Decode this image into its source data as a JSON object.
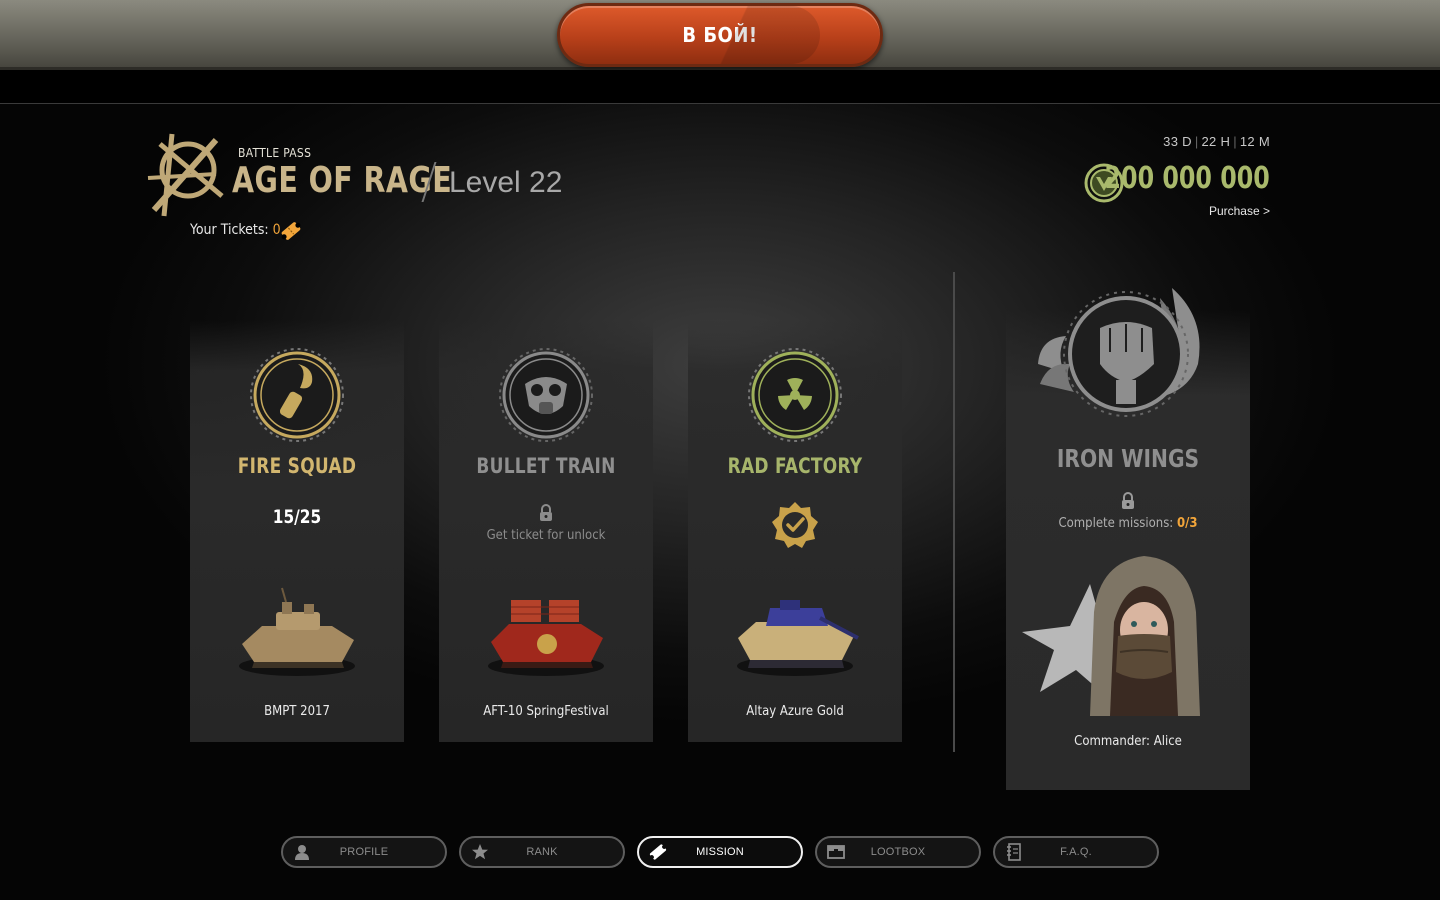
{
  "top_bar": {
    "battle_button_label": "В БОЙ!"
  },
  "header": {
    "subtitle": "BATTLE PASS",
    "title": "AGE OF RAGE",
    "level": "Level 22",
    "tickets_label": "Your Tickets: ",
    "tickets_value": "0",
    "timer": {
      "days": "33 D",
      "hours": "22 H",
      "minutes": "12 M"
    },
    "currency_amount": "200 000 000",
    "purchase_label": "Purchase >"
  },
  "cards": [
    {
      "title": "FIRE SQUAD",
      "title_color": "#d2b66f",
      "progress": "15/25",
      "vehicle": "BMPT 2017",
      "state": "in-progress"
    },
    {
      "title": "BULLET TRAIN",
      "title_color": "#8f8f8f",
      "lock_text": "Get ticket for unlock",
      "vehicle": "AFT-10 SpringFestival",
      "state": "locked"
    },
    {
      "title": "RAD FACTORY",
      "title_color": "#a7b56b",
      "vehicle": "Altay Azure Gold",
      "state": "completed"
    }
  ],
  "special_card": {
    "title": "IRON WINGS",
    "missions_label": "Complete missions: ",
    "missions_value": "0/3",
    "reward": "Commander: Alice"
  },
  "nav": [
    {
      "label": "PROFILE",
      "icon": "user-icon",
      "active": false
    },
    {
      "label": "RANK",
      "icon": "star-icon",
      "active": false
    },
    {
      "label": "MISSION",
      "icon": "ticket-icon",
      "active": true
    },
    {
      "label": "LOOTBOX",
      "icon": "box-icon",
      "active": false
    },
    {
      "label": "F.A.Q.",
      "icon": "notebook-icon",
      "active": false
    }
  ],
  "colors": {
    "accent_gold": "#c9b58a",
    "currency_green": "#a9b96c",
    "ticket_orange": "#f2a53a",
    "battle_red": "#c9471c"
  }
}
